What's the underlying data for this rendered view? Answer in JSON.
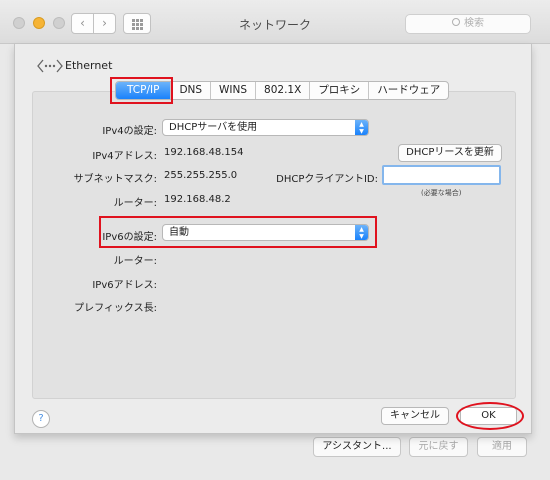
{
  "window": {
    "title": "ネットワーク",
    "search_placeholder": "検索"
  },
  "header": {
    "interface_name": "Ethernet"
  },
  "tabs": [
    {
      "label": "TCP/IP",
      "selected": true
    },
    {
      "label": "DNS"
    },
    {
      "label": "WINS"
    },
    {
      "label": "802.1X"
    },
    {
      "label": "プロキシ"
    },
    {
      "label": "ハードウェア"
    }
  ],
  "ipv4": {
    "config_label": "IPv4の設定:",
    "config_value": "DHCPサーバを使用",
    "address_label": "IPv4アドレス:",
    "address_value": "192.168.48.154",
    "subnet_label": "サブネットマスク:",
    "subnet_value": "255.255.255.0",
    "router_label": "ルーター:",
    "router_value": "192.168.48.2",
    "renew_button": "DHCPリースを更新",
    "client_id_label": "DHCPクライアントID:",
    "client_id_value": "",
    "client_id_hint": "(必要な場合)"
  },
  "ipv6": {
    "config_label": "IPv6の設定:",
    "config_value": "自動",
    "router_label": "ルーター:",
    "address_label": "IPv6アドレス:",
    "prefix_label": "プレフィックス長:"
  },
  "footer": {
    "help": "?",
    "cancel": "キャンセル",
    "ok": "OK"
  },
  "background_buttons": {
    "assistant": "アシスタント...",
    "revert": "元に戻す",
    "apply": "適用"
  },
  "colors": {
    "accent": "#1a82fb",
    "highlight": "#e0121e"
  }
}
